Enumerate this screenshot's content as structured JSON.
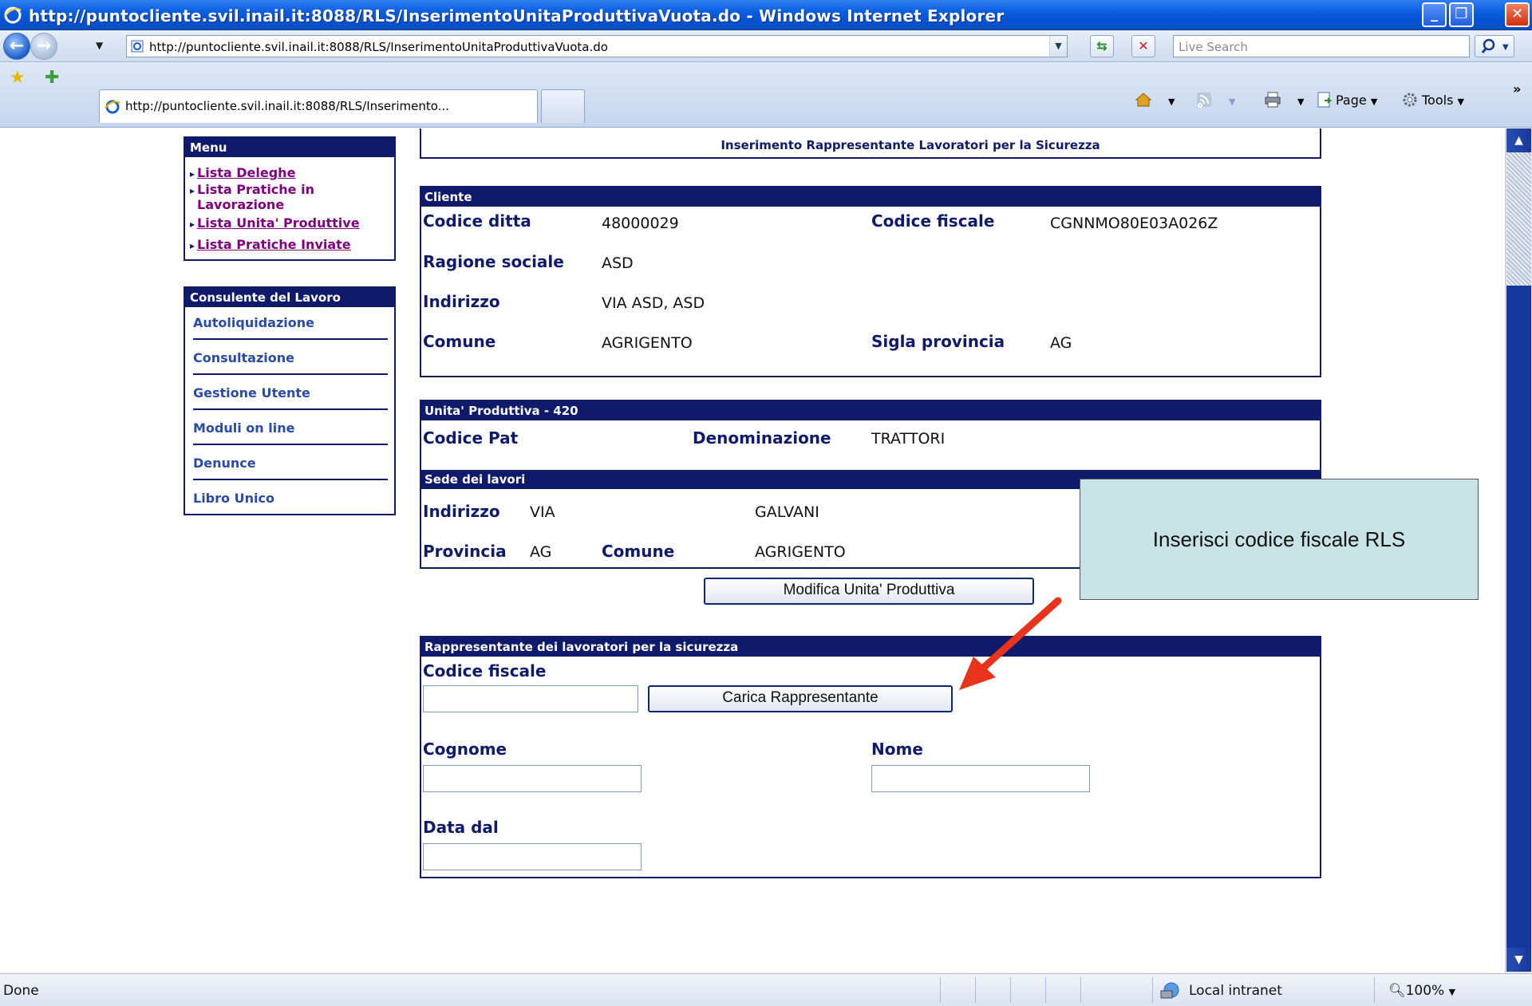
{
  "window": {
    "title": "http://puntocliente.svil.inail.it:8088/RLS/InserimentoUnitaProduttivaVuota.do - Windows Internet Explorer",
    "min_glyph": "_",
    "max_glyph": "❐",
    "close_glyph": "✕"
  },
  "address": {
    "url": "http://puntocliente.svil.inail.it:8088/RLS/InserimentoUnitaProduttivaVuota.do",
    "search_placeholder": "Live Search"
  },
  "tabs": [
    {
      "label": "http://puntocliente.svil.inail.it:8088/RLS/Inserimento..."
    }
  ],
  "commands": {
    "page": "Page",
    "tools": "Tools",
    "more": "»"
  },
  "menu": {
    "title": "Menu",
    "items": [
      {
        "label": "Lista Deleghe"
      },
      {
        "label": "Lista Pratiche in",
        "label2": "Lavorazione"
      },
      {
        "label": "Lista Unita' Produttive"
      },
      {
        "label": "Lista Pratiche Inviate"
      }
    ]
  },
  "consulente": {
    "title": "Consulente del Lavoro",
    "items": [
      {
        "label": "Autoliquidazione"
      },
      {
        "label": "Consultazione"
      },
      {
        "label": "Gestione Utente"
      },
      {
        "label": "Moduli on line"
      },
      {
        "label": "Denunce"
      },
      {
        "label": "Libro Unico"
      }
    ]
  },
  "page_title": "Inserimento Rappresentante Lavoratori per la Sicurezza",
  "cliente": {
    "title": "Cliente",
    "codice_ditta_label": "Codice ditta",
    "codice_ditta": "48000029",
    "codice_fiscale_label": "Codice fiscale",
    "codice_fiscale": "CGNNMO80E03A026Z",
    "ragione_sociale_label": "Ragione sociale",
    "ragione_sociale": "ASD",
    "indirizzo_label": "Indirizzo",
    "indirizzo": "VIA ASD, ASD",
    "comune_label": "Comune",
    "comune": "AGRIGENTO",
    "sigla_provincia_label": "Sigla provincia",
    "sigla_provincia": "AG"
  },
  "unita": {
    "title": "Unita' Produttiva - 420",
    "codice_pat_label": "Codice Pat",
    "denominazione_label": "Denominazione",
    "denominazione": "TRATTORI",
    "sede_title": "Sede dei lavori",
    "indirizzo_label": "Indirizzo",
    "indirizzo_tipo": "VIA",
    "indirizzo_nome": "GALVANI",
    "provincia_label": "Provincia",
    "provincia": "AG",
    "comune_label": "Comune",
    "comune": "AGRIGENTO",
    "modifica_button": "Modifica Unita' Produttiva"
  },
  "rls": {
    "title": "Rappresentante dei lavoratori per la sicurezza",
    "codice_fiscale_label": "Codice fiscale",
    "carica_button": "Carica Rappresentante",
    "cognome_label": "Cognome",
    "nome_label": "Nome",
    "data_dal_label": "Data dal"
  },
  "callout": {
    "text": "Inserisci codice fiscale RLS"
  },
  "status": {
    "text": "Done",
    "zone": "Local intranet",
    "zoom": "100%"
  },
  "colors": {
    "header_navy": "#0f1a6a",
    "link_purple": "#800080",
    "callout_fill": "#c8e3e6",
    "arrow_red": "#e8341c"
  }
}
